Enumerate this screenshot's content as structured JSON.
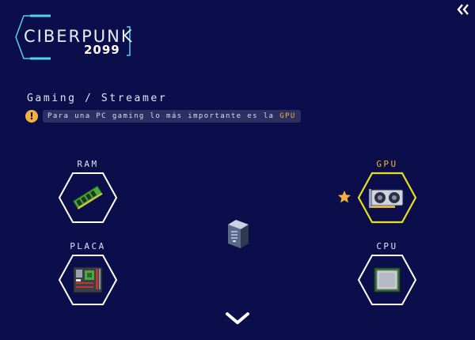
{
  "logo": {
    "word": "CIBERPUNK",
    "year": "2099"
  },
  "collapse_icon": "double-chevron-left-icon",
  "profile_title": "Gaming / Streamer",
  "hint": {
    "icon": "warning-icon",
    "text_before": "Para una PC gaming lo más importante es la ",
    "highlight": "GPU"
  },
  "components": {
    "ram": {
      "label": "RAM",
      "icon": "ram-stick-icon",
      "selected": false
    },
    "gpu": {
      "label": "GPU",
      "icon": "graphics-card-icon",
      "selected": true
    },
    "placa": {
      "label": "PLACA",
      "icon": "motherboard-icon",
      "selected": false
    },
    "cpu": {
      "label": "CPU",
      "icon": "processor-chip-icon",
      "selected": false
    }
  },
  "center_icon": "pc-tower-icon",
  "expand_icon": "chevron-down-icon",
  "colors": {
    "background": "#0b0e4a",
    "accent": "#f2b23a",
    "highlight_border": "#e6e01f",
    "hex_border": "#ffffff",
    "logo_frame": "#4fd4e8"
  }
}
